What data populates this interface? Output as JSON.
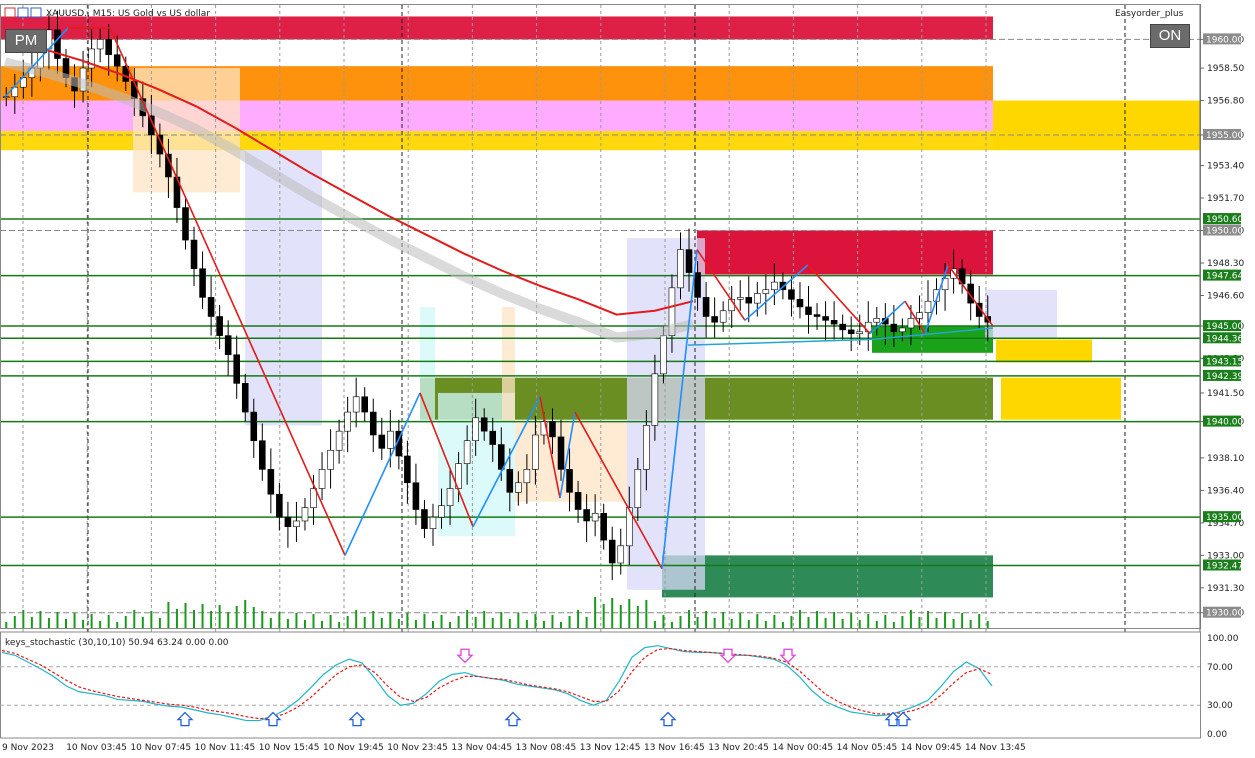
{
  "header": {
    "symbol_info": "XAUUSD., M15: US Gold vs US dollar",
    "expert": "Easyorder_plus",
    "pm_button": "PM",
    "on_button": "ON"
  },
  "chart_data": {
    "type": "candlestick",
    "symbol": "XAUUSD.",
    "timeframe": "M15",
    "ylim": [
      1929.2,
      1961.8
    ],
    "price_ticks": [
      "1960.00",
      "1958.50",
      "1956.80",
      "1955.00",
      "1953.40",
      "1951.70",
      "1950.00",
      "1948.30",
      "1946.60",
      "1945.00",
      "1943.30",
      "1941.50",
      "1940.00",
      "1938.10",
      "1936.40",
      "1934.70",
      "1933.00",
      "1931.30",
      "1930.00"
    ],
    "price_labels": [
      {
        "text": "1950.60",
        "color": "#1a7f1a"
      },
      {
        "text": "1950.00",
        "color": "#8c8c8c"
      },
      {
        "text": "1947.64",
        "color": "#1a7f1a"
      },
      {
        "text": "1945.00",
        "color": "#1a7f1a"
      },
      {
        "text": "1944.36",
        "color": "#1a7f1a"
      },
      {
        "text": "1943.15",
        "color": "#1a7f1a"
      },
      {
        "text": "1942.39",
        "color": "#1a7f1a"
      },
      {
        "text": "1940.00",
        "color": "#1a7f1a"
      },
      {
        "text": "1935.00",
        "color": "#1a7f1a"
      },
      {
        "text": "1932.47",
        "color": "#1a7f1a"
      },
      {
        "text": "1930.00",
        "color": "#8c8c8c"
      },
      {
        "text": "1955.00",
        "color": "#8c8c8c"
      },
      {
        "text": "1960.00",
        "color": "#8c8c8c"
      }
    ],
    "time_labels": [
      "9 Nov 2023",
      "10 Nov 03:45",
      "10 Nov 07:45",
      "10 Nov 11:45",
      "10 Nov 15:45",
      "10 Nov 19:45",
      "10 Nov 23:45",
      "13 Nov 04:45",
      "13 Nov 08:45",
      "13 Nov 12:45",
      "13 Nov 16:45",
      "13 Nov 20:45",
      "14 Nov 00:45",
      "14 Nov 05:45",
      "14 Nov 09:45",
      "14 Nov 13:45"
    ],
    "close_path": [
      1957,
      1957.5,
      1958,
      1958.5,
      1959.5,
      1960.5,
      1959,
      1958,
      1957.3,
      1958.5,
      1959.5,
      1960,
      1959.2,
      1958.6,
      1957.8,
      1956.9,
      1956,
      1955,
      1954,
      1952.8,
      1951.2,
      1949.5,
      1948,
      1946.5,
      1945.5,
      1944.5,
      1943.5,
      1942,
      1940.5,
      1939,
      1937.5,
      1936.2,
      1935,
      1934.5,
      1934.8,
      1935.5,
      1936.5,
      1937.5,
      1938.5,
      1939.5,
      1940.5,
      1941.3,
      1940.5,
      1939.3,
      1938.6,
      1939.5,
      1938.2,
      1936.8,
      1935.4,
      1934.4,
      1935,
      1935.6,
      1936.5,
      1937.8,
      1939,
      1940.2,
      1939.5,
      1938.8,
      1937.5,
      1936.3,
      1936.8,
      1937.5,
      1939.3,
      1940,
      1939.2,
      1937.5,
      1936.3,
      1935.4,
      1934.8,
      1935.2,
      1933.8,
      1932.6,
      1933.5,
      1935.5,
      1937.5,
      1939.8,
      1942.5,
      1944.5,
      1947,
      1949,
      1947.8,
      1946.5,
      1945.5,
      1945.2,
      1945.8,
      1946.4,
      1946.5,
      1946.2,
      1946.7,
      1946.9,
      1947.3,
      1946.9,
      1946.4,
      1946,
      1945.6,
      1945.5,
      1945.3,
      1945.1,
      1944.8,
      1944.6,
      1944.7,
      1945.2,
      1945.4,
      1945.1,
      1944.7,
      1944.9,
      1945.4,
      1945.7,
      1946.3,
      1946.9,
      1947.5,
      1948,
      1947.2,
      1946.2,
      1945.5,
      1945.2
    ],
    "red_ma": [
      1960,
      1959.5,
      1958.9,
      1958.2,
      1957.4,
      1956.5,
      1955.4,
      1954.2,
      1953,
      1951.9,
      1950.8,
      1949.8,
      1948.8,
      1947.9,
      1947.1,
      1946.4,
      1945.6,
      1945.8,
      1946.3
    ],
    "sessions_vlines": [
      "10 Nov 03:45",
      "10 Nov 15:45",
      "10 Nov 23:45",
      "13 Nov 16:45",
      "14 Nov 05:45"
    ],
    "zones": [
      {
        "name": "resistance-red",
        "color": "#dc143c",
        "price": [
          1960,
          1961.2
        ]
      },
      {
        "name": "orange",
        "color": "#ff8c00",
        "price": [
          1956.8,
          1958.6
        ]
      },
      {
        "name": "pink",
        "color": "#ffa6ff",
        "price": [
          1955.2,
          1956.8
        ]
      },
      {
        "name": "gold",
        "color": "#ffd700",
        "price": [
          1954.2,
          1955.2
        ]
      }
    ],
    "levels": [
      1950.6,
      1947.64,
      1945.0,
      1944.36,
      1943.15,
      1942.39,
      1940.0,
      1935.0,
      1932.47
    ],
    "dashed_levels": [
      1960.0,
      1955.0,
      1950.0,
      1930.0
    ],
    "stochastic": {
      "label": "keys_stochastic (30,10,10) 50.94 63.24 0.00 0.00",
      "ticks": [
        "100.00",
        "70.00",
        "30.00",
        "0.00"
      ],
      "main": [
        85,
        82,
        75,
        68,
        60,
        50,
        44,
        42,
        40,
        36,
        35,
        34,
        31,
        29,
        28,
        25,
        22,
        20,
        17,
        14,
        14,
        18,
        25,
        35,
        48,
        62,
        72,
        78,
        74,
        58,
        40,
        30,
        32,
        42,
        55,
        62,
        64,
        60,
        58,
        56,
        52,
        50,
        48,
        46,
        42,
        35,
        30,
        35,
        55,
        80,
        90,
        92,
        89,
        86,
        85,
        85,
        84,
        82,
        82,
        80,
        78,
        72,
        60,
        45,
        34,
        28,
        23,
        21,
        19,
        20,
        24,
        29,
        35,
        49,
        65,
        75,
        68,
        50
      ],
      "signal": [
        87,
        84,
        78,
        72,
        64,
        56,
        49,
        45,
        42,
        39,
        37,
        35,
        33,
        31,
        30,
        28,
        25,
        23,
        21,
        18,
        16,
        17,
        21,
        28,
        38,
        50,
        62,
        70,
        72,
        64,
        50,
        38,
        34,
        38,
        48,
        55,
        60,
        60,
        58,
        57,
        54,
        51,
        49,
        47,
        44,
        39,
        34,
        34,
        45,
        65,
        80,
        88,
        89,
        87,
        86,
        85,
        84,
        83,
        82,
        81,
        79,
        75,
        66,
        54,
        42,
        34,
        28,
        24,
        21,
        21,
        22,
        25,
        30,
        40,
        53,
        64,
        68,
        62
      ],
      "signals_down": [
        4,
        14,
        17
      ],
      "signals_up": [
        2,
        6,
        10,
        12,
        15,
        21,
        22
      ]
    }
  }
}
